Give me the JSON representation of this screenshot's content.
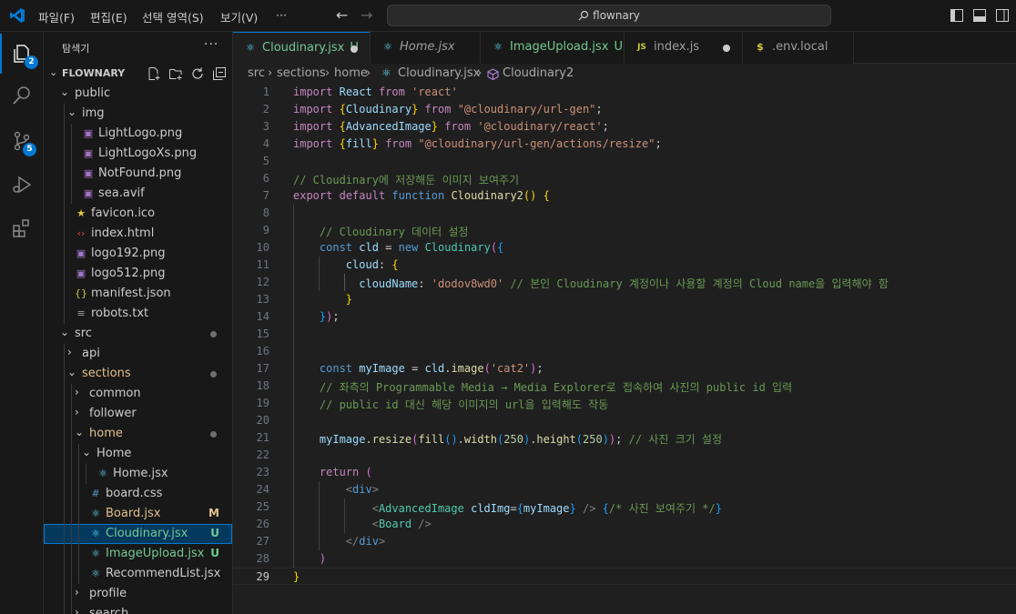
{
  "titlebar": {
    "menu": [
      "파일(F)",
      "편집(E)",
      "선택 영역(S)",
      "보기(V)",
      "···"
    ],
    "search_text": "flownary"
  },
  "activitybar": {
    "explorer_badge": "2",
    "scm_badge": "5"
  },
  "sidebar": {
    "title": "탐색기",
    "more": "···",
    "root": "FLOWNARY",
    "tree": [
      {
        "label": "public",
        "type": "folder-open"
      },
      {
        "label": "img",
        "type": "folder-open"
      },
      {
        "label": "LightLogo.png",
        "type": "image"
      },
      {
        "label": "LightLogoXs.png",
        "type": "image"
      },
      {
        "label": "NotFound.png",
        "type": "image"
      },
      {
        "label": "sea.avif",
        "type": "image"
      },
      {
        "label": "favicon.ico",
        "type": "star"
      },
      {
        "label": "index.html",
        "type": "html"
      },
      {
        "label": "logo192.png",
        "type": "image"
      },
      {
        "label": "logo512.png",
        "type": "image"
      },
      {
        "label": "manifest.json",
        "type": "json"
      },
      {
        "label": "robots.txt",
        "type": "txt"
      },
      {
        "label": "src",
        "type": "folder-open",
        "dot": true
      },
      {
        "label": "api",
        "type": "folder-closed"
      },
      {
        "label": "sections",
        "type": "folder-open",
        "dot": true,
        "modified": true
      },
      {
        "label": "common",
        "type": "folder-closed"
      },
      {
        "label": "follower",
        "type": "folder-closed"
      },
      {
        "label": "home",
        "type": "folder-open",
        "dot": true,
        "modified": true
      },
      {
        "label": "Home",
        "type": "folder-open"
      },
      {
        "label": "Home.jsx",
        "type": "react"
      },
      {
        "label": "board.css",
        "type": "css"
      },
      {
        "label": "Board.jsx",
        "type": "react",
        "status": "M"
      },
      {
        "label": "Cloudinary.jsx",
        "type": "react",
        "status": "U",
        "selected": true
      },
      {
        "label": "ImageUpload.jsx",
        "type": "react",
        "status": "U"
      },
      {
        "label": "RecommendList.jsx",
        "type": "react"
      },
      {
        "label": "profile",
        "type": "folder-closed"
      },
      {
        "label": "search",
        "type": "folder-closed"
      }
    ]
  },
  "tabs": [
    {
      "label": "Cloudinary.jsx",
      "suffix": "U",
      "icon": "react",
      "active": true,
      "dirty": true
    },
    {
      "label": "Home.jsx",
      "suffix": "",
      "icon": "react",
      "italic": true
    },
    {
      "label": "ImageUpload.jsx",
      "suffix": "U",
      "icon": "react"
    },
    {
      "label": "index.js",
      "suffix": "",
      "icon": "js",
      "dirty": true
    },
    {
      "label": ".env.local",
      "suffix": "",
      "icon": "env"
    }
  ],
  "breadcrumb": [
    "src",
    "sections",
    "home",
    "Cloudinary.jsx",
    "Cloudinary2"
  ],
  "editor": {
    "line_numbers": [
      "1",
      "2",
      "3",
      "4",
      "5",
      "6",
      "7",
      "8",
      "9",
      "10",
      "11",
      "12",
      "13",
      "14",
      "15",
      "16",
      "17",
      "18",
      "19",
      "20",
      "21",
      "22",
      "23",
      "24",
      "25",
      "26",
      "27",
      "28",
      "29"
    ],
    "lines": [
      "import React from 'react'",
      "import {Cloudinary} from \"@cloudinary/url-gen\";",
      "import {AdvancedImage} from '@cloudinary/react';",
      "import {fill} from \"@cloudinary/url-gen/actions/resize\";",
      "",
      "// Cloudinary에 저장해둔 이미지 보여주기",
      "export default function Cloudinary2() {",
      "",
      "    // Cloudinary 데이터 설정",
      "    const cld = new Cloudinary({",
      "        cloud: {",
      "          cloudName: 'dodov8wd0' // 본인 Cloudinary 계정이나 사용할 계정의 Cloud name을 입력해야 함",
      "        }",
      "    });",
      "",
      "",
      "    const myImage = cld.image('cat2');",
      "    // 좌측의 Programmable Media → Media Explorer로 접속하여 사진의 public id 입력",
      "    // public id 대신 해당 이미지의 url을 입력해도 작동",
      "",
      "    myImage.resize(fill().width(250).height(250)); // 사진 크기 설정",
      "",
      "    return (",
      "        <div>",
      "            <AdvancedImage cldImg={myImage} /> {/* 사진 보여주기 */}",
      "            <Board />",
      "        </div>",
      "    )",
      "}"
    ]
  },
  "colors": {
    "accent": "#0078d4",
    "selection": "#04395e",
    "untracked": "#73c991",
    "modified": "#e2c08d"
  }
}
